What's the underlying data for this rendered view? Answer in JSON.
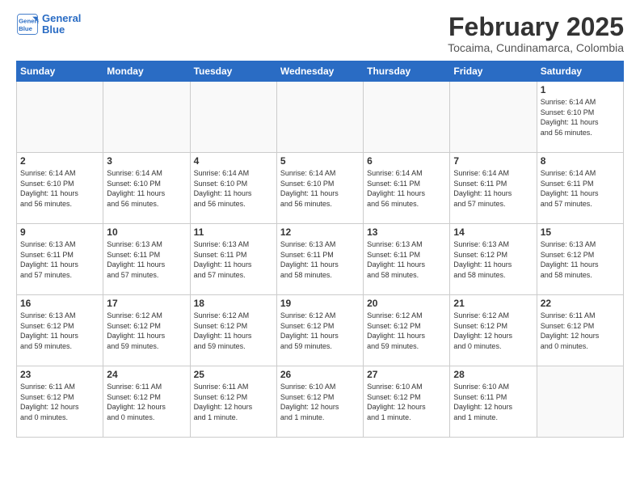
{
  "logo": {
    "line1": "General",
    "line2": "Blue"
  },
  "title": "February 2025",
  "subtitle": "Tocaima, Cundinamarca, Colombia",
  "days_of_week": [
    "Sunday",
    "Monday",
    "Tuesday",
    "Wednesday",
    "Thursday",
    "Friday",
    "Saturday"
  ],
  "weeks": [
    [
      {
        "day": "",
        "info": ""
      },
      {
        "day": "",
        "info": ""
      },
      {
        "day": "",
        "info": ""
      },
      {
        "day": "",
        "info": ""
      },
      {
        "day": "",
        "info": ""
      },
      {
        "day": "",
        "info": ""
      },
      {
        "day": "1",
        "info": "Sunrise: 6:14 AM\nSunset: 6:10 PM\nDaylight: 11 hours\nand 56 minutes."
      }
    ],
    [
      {
        "day": "2",
        "info": "Sunrise: 6:14 AM\nSunset: 6:10 PM\nDaylight: 11 hours\nand 56 minutes."
      },
      {
        "day": "3",
        "info": "Sunrise: 6:14 AM\nSunset: 6:10 PM\nDaylight: 11 hours\nand 56 minutes."
      },
      {
        "day": "4",
        "info": "Sunrise: 6:14 AM\nSunset: 6:10 PM\nDaylight: 11 hours\nand 56 minutes."
      },
      {
        "day": "5",
        "info": "Sunrise: 6:14 AM\nSunset: 6:10 PM\nDaylight: 11 hours\nand 56 minutes."
      },
      {
        "day": "6",
        "info": "Sunrise: 6:14 AM\nSunset: 6:11 PM\nDaylight: 11 hours\nand 56 minutes."
      },
      {
        "day": "7",
        "info": "Sunrise: 6:14 AM\nSunset: 6:11 PM\nDaylight: 11 hours\nand 57 minutes."
      },
      {
        "day": "8",
        "info": "Sunrise: 6:14 AM\nSunset: 6:11 PM\nDaylight: 11 hours\nand 57 minutes."
      }
    ],
    [
      {
        "day": "9",
        "info": "Sunrise: 6:13 AM\nSunset: 6:11 PM\nDaylight: 11 hours\nand 57 minutes."
      },
      {
        "day": "10",
        "info": "Sunrise: 6:13 AM\nSunset: 6:11 PM\nDaylight: 11 hours\nand 57 minutes."
      },
      {
        "day": "11",
        "info": "Sunrise: 6:13 AM\nSunset: 6:11 PM\nDaylight: 11 hours\nand 57 minutes."
      },
      {
        "day": "12",
        "info": "Sunrise: 6:13 AM\nSunset: 6:11 PM\nDaylight: 11 hours\nand 58 minutes."
      },
      {
        "day": "13",
        "info": "Sunrise: 6:13 AM\nSunset: 6:11 PM\nDaylight: 11 hours\nand 58 minutes."
      },
      {
        "day": "14",
        "info": "Sunrise: 6:13 AM\nSunset: 6:12 PM\nDaylight: 11 hours\nand 58 minutes."
      },
      {
        "day": "15",
        "info": "Sunrise: 6:13 AM\nSunset: 6:12 PM\nDaylight: 11 hours\nand 58 minutes."
      }
    ],
    [
      {
        "day": "16",
        "info": "Sunrise: 6:13 AM\nSunset: 6:12 PM\nDaylight: 11 hours\nand 59 minutes."
      },
      {
        "day": "17",
        "info": "Sunrise: 6:12 AM\nSunset: 6:12 PM\nDaylight: 11 hours\nand 59 minutes."
      },
      {
        "day": "18",
        "info": "Sunrise: 6:12 AM\nSunset: 6:12 PM\nDaylight: 11 hours\nand 59 minutes."
      },
      {
        "day": "19",
        "info": "Sunrise: 6:12 AM\nSunset: 6:12 PM\nDaylight: 11 hours\nand 59 minutes."
      },
      {
        "day": "20",
        "info": "Sunrise: 6:12 AM\nSunset: 6:12 PM\nDaylight: 11 hours\nand 59 minutes."
      },
      {
        "day": "21",
        "info": "Sunrise: 6:12 AM\nSunset: 6:12 PM\nDaylight: 12 hours\nand 0 minutes."
      },
      {
        "day": "22",
        "info": "Sunrise: 6:11 AM\nSunset: 6:12 PM\nDaylight: 12 hours\nand 0 minutes."
      }
    ],
    [
      {
        "day": "23",
        "info": "Sunrise: 6:11 AM\nSunset: 6:12 PM\nDaylight: 12 hours\nand 0 minutes."
      },
      {
        "day": "24",
        "info": "Sunrise: 6:11 AM\nSunset: 6:12 PM\nDaylight: 12 hours\nand 0 minutes."
      },
      {
        "day": "25",
        "info": "Sunrise: 6:11 AM\nSunset: 6:12 PM\nDaylight: 12 hours\nand 1 minute."
      },
      {
        "day": "26",
        "info": "Sunrise: 6:10 AM\nSunset: 6:12 PM\nDaylight: 12 hours\nand 1 minute."
      },
      {
        "day": "27",
        "info": "Sunrise: 6:10 AM\nSunset: 6:12 PM\nDaylight: 12 hours\nand 1 minute."
      },
      {
        "day": "28",
        "info": "Sunrise: 6:10 AM\nSunset: 6:11 PM\nDaylight: 12 hours\nand 1 minute."
      },
      {
        "day": "",
        "info": ""
      }
    ]
  ]
}
